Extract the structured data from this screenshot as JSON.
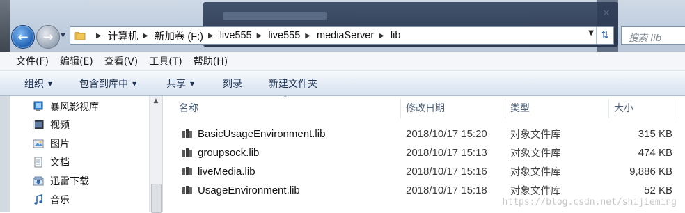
{
  "address": {
    "crumbs": [
      "计算机",
      "新加卷 (F:)",
      "live555",
      "live555",
      "mediaServer",
      "lib"
    ]
  },
  "search": {
    "placeholder": "搜索 lib"
  },
  "menu": [
    "文件(F)",
    "编辑(E)",
    "查看(V)",
    "工具(T)",
    "帮助(H)"
  ],
  "commands": {
    "organize": "组织",
    "include": "包含到库中",
    "share": "共享",
    "burn": "刻录",
    "new_folder": "新建文件夹"
  },
  "nav": [
    {
      "label": "暴风影视库",
      "icon": "media-library-icon"
    },
    {
      "label": "视频",
      "icon": "video-library-icon"
    },
    {
      "label": "图片",
      "icon": "pictures-library-icon"
    },
    {
      "label": "文档",
      "icon": "documents-library-icon"
    },
    {
      "label": "迅雷下载",
      "icon": "download-library-icon"
    },
    {
      "label": "音乐",
      "icon": "music-library-icon"
    }
  ],
  "columns": {
    "name": "名称",
    "date": "修改日期",
    "type": "类型",
    "size": "大小"
  },
  "files": [
    {
      "name": "BasicUsageEnvironment.lib",
      "date": "2018/10/17 15:20",
      "type": "对象文件库",
      "size": "315 KB"
    },
    {
      "name": "groupsock.lib",
      "date": "2018/10/17 15:13",
      "type": "对象文件库",
      "size": "474 KB"
    },
    {
      "name": "liveMedia.lib",
      "date": "2018/10/17 15:16",
      "type": "对象文件库",
      "size": "9,886 KB"
    },
    {
      "name": "UsageEnvironment.lib",
      "date": "2018/10/17 15:18",
      "type": "对象文件库",
      "size": "52 KB"
    }
  ],
  "watermark": "https://blog.csdn.net/shijieming",
  "colors": {
    "accent": "#1f5fb4",
    "header_text": "#4c607a",
    "command_text": "#1e3354"
  }
}
